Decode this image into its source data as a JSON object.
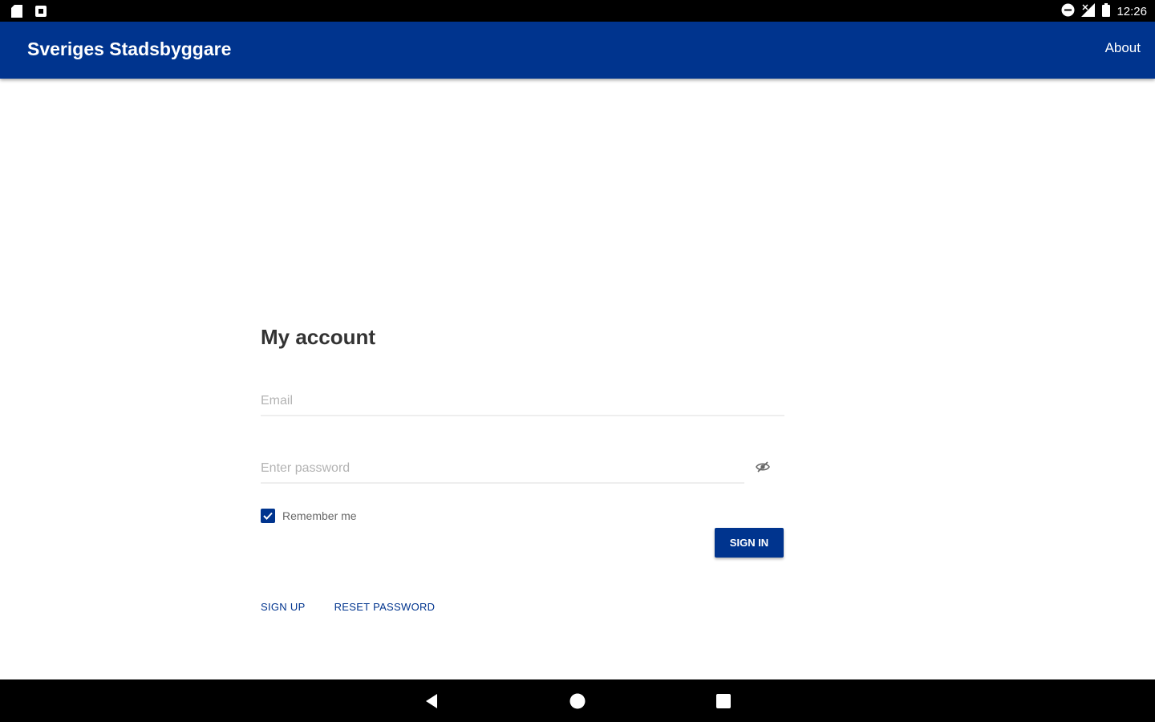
{
  "status_bar": {
    "time": "12:26",
    "left_icons": [
      "sd-card-icon",
      "notification-icon"
    ],
    "right_icons": [
      "dnd-icon",
      "signal-icon",
      "battery-icon"
    ]
  },
  "app_bar": {
    "title": "Sveriges Stadsbyggare",
    "about_label": "About",
    "color": "#00348e"
  },
  "form": {
    "title": "My account",
    "email": {
      "value": "",
      "placeholder": "Email"
    },
    "password": {
      "value": "",
      "placeholder": "Enter password"
    },
    "remember_me": {
      "label": "Remember me",
      "checked": true
    },
    "sign_in_label": "SIGN IN"
  },
  "links": {
    "sign_up": "SIGN UP",
    "reset_password": "RESET PASSWORD"
  },
  "nav_bar": {
    "buttons": [
      "back-icon",
      "home-icon",
      "recents-icon"
    ]
  }
}
